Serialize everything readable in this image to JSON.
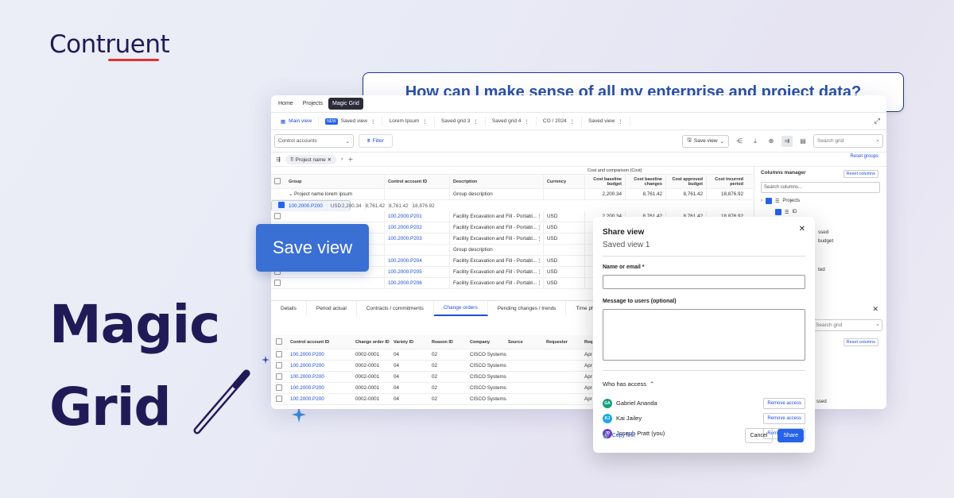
{
  "brand": {
    "logo": "Contruent"
  },
  "hero": {
    "line1": "Magic",
    "line2": "Grid"
  },
  "callout": {
    "text": "How can I make sense of all my enterprise and project data?"
  },
  "save_pill": {
    "label": "Save view"
  },
  "app": {
    "nav": [
      "Home",
      "Projects",
      "Magic Grid"
    ],
    "view_tabs": [
      "Main view",
      "Saved view",
      "Lorem Ipsum",
      "Saved grid 3",
      "Saved grid 4",
      "CO / 2024",
      "Saved view"
    ],
    "new_badge": "NEW",
    "toolbar": {
      "select": "Control accounts",
      "filter": "Filter",
      "save_view": "Save view",
      "search_placeholder": "Search grid"
    },
    "group_chip": "Project name",
    "reset_groups": "Reset groups",
    "grid": {
      "group_header": "Cost and comparison (Cost)",
      "headers": [
        "Group",
        "Control account ID",
        "Description",
        "Currency",
        "Cost baseline budget",
        "Cost baseline changes",
        "Cost approved budget",
        "Cost incurred period"
      ],
      "group_row": {
        "name": "Project name lorem ipsum",
        "desc": "Group description",
        "v": [
          "2,200.34",
          "8,761.42",
          "8,761.42",
          "18,876.92"
        ]
      },
      "rows": [
        {
          "id": "100.2000.P200",
          "desc": "Facility Excavation and Fill - Portabl...",
          "cur": "USD",
          "v": [
            "2,200.34",
            "8,761.42",
            "8,761.42",
            "18,876.92"
          ]
        },
        {
          "id": "100.2000.P201",
          "desc": "Facility Excavation and Fill - Portabl...",
          "cur": "USD",
          "v": [
            "2,200.34",
            "8,761.42",
            "8,761.42",
            "18,876.92"
          ]
        },
        {
          "id": "100.2000.P202",
          "desc": "Facility Excavation and Fill - Portabl...",
          "cur": "USD",
          "v": [
            "",
            "",
            "",
            ""
          ]
        },
        {
          "id": "100.2000.P203",
          "desc": "Facility Excavation and Fill - Portabl...",
          "cur": "USD",
          "v": [
            "",
            "",
            "",
            ""
          ]
        },
        {
          "id": "",
          "desc": "Group description",
          "cur": "",
          "v": [
            "",
            "",
            "",
            ""
          ]
        },
        {
          "id": "100.2000.P204",
          "desc": "Facility Excavation and Fill - Portabl...",
          "cur": "USD",
          "v": [
            "",
            "",
            "",
            ""
          ]
        },
        {
          "id": "100.2000.P205",
          "desc": "Facility Excavation and Fill - Portabl...",
          "cur": "USD",
          "v": [
            "",
            "",
            "",
            ""
          ]
        },
        {
          "id": "100.2000.P206",
          "desc": "Facility Excavation and Fill - Portabl...",
          "cur": "USD",
          "v": [
            "",
            "",
            "",
            ""
          ]
        }
      ]
    },
    "columns_manager": {
      "title": "Columns manager",
      "reset": "Reset columns",
      "search": "Search columns...",
      "projects": "Projects",
      "id": "ID",
      "tails": [
        "ssed",
        "budget",
        "ted"
      ]
    },
    "bottom_tabs": [
      "Details",
      "Period actual",
      "Contracts / commitments",
      "Change orders",
      "Pending changes / trends",
      "Time pha"
    ],
    "btable": {
      "headers": [
        "Control account ID",
        "Change order ID",
        "Variety ID",
        "Reason ID",
        "Company",
        "Source",
        "Requester",
        "Req"
      ],
      "rows": [
        {
          "id": "100.2000.P200",
          "co": "0002-0001",
          "var": "04",
          "rs": "02",
          "company": "CISCO Systems",
          "tail": "Apr"
        },
        {
          "id": "100.2000.P200",
          "co": "0002-0001",
          "var": "04",
          "rs": "02",
          "company": "CISCO Systems",
          "tail": "Apr"
        },
        {
          "id": "100.2000.P200",
          "co": "0002-0001",
          "var": "04",
          "rs": "02",
          "company": "CISCO Systems",
          "tail": "Apr"
        },
        {
          "id": "100.2000.P200",
          "co": "0002-0001",
          "var": "04",
          "rs": "02",
          "company": "CISCO Systems",
          "tail": "Apr"
        },
        {
          "id": "100.2000.P200",
          "co": "0002-0001",
          "var": "04",
          "rs": "02",
          "company": "CISCO Systems",
          "tail": "Apr"
        }
      ]
    },
    "panel2": {
      "search": "Search grid",
      "reset": "Reset columns",
      "tail": "ssed"
    }
  },
  "share": {
    "title": "Share view",
    "subtitle": "Saved view 1",
    "name_label": "Name or email *",
    "message_label": "Message to users (optional)",
    "who": "Who has access",
    "people": [
      {
        "initials": "GA",
        "name": "Gabriel Ananda",
        "color": "#13a07a",
        "action": "Remove access"
      },
      {
        "initials": "KJ",
        "name": "Kai Jailey",
        "color": "#1ea7e6",
        "action": "Remove access"
      },
      {
        "initials": "JP",
        "name": "Joseph Pratt (you)",
        "color": "#6b3fc4",
        "action": "Remove access"
      }
    ],
    "copy_link": "Copy link",
    "cancel": "Cancel",
    "share": "Share"
  }
}
